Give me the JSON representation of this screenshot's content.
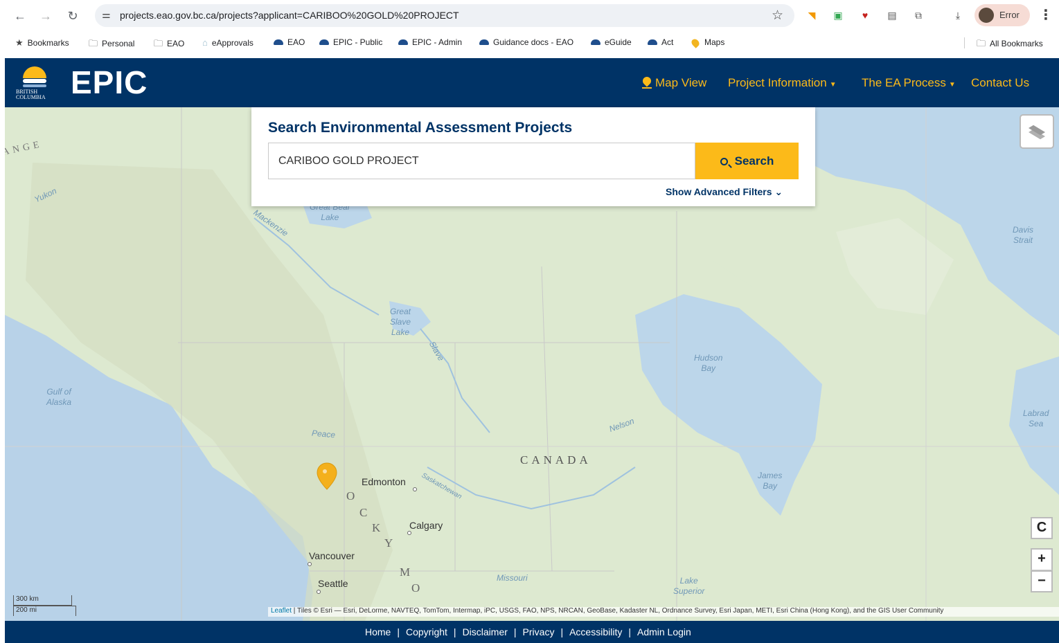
{
  "browser": {
    "url": "projects.eao.gov.bc.ca/projects?applicant=CARIBOO%20GOLD%20PROJECT",
    "profile_label": "Error",
    "bookmarks": [
      {
        "label": "Bookmarks",
        "icon": "star-icon"
      },
      {
        "label": "Personal",
        "icon": "folder-icon"
      },
      {
        "label": "EAO",
        "icon": "folder-icon"
      },
      {
        "label": "eApprovals",
        "icon": "site-icon"
      },
      {
        "label": "EAO",
        "icon": "bc-cloud-icon"
      },
      {
        "label": "EPIC - Public",
        "icon": "bc-cloud-icon"
      },
      {
        "label": "EPIC - Admin",
        "icon": "bc-cloud-icon"
      },
      {
        "label": "Guidance docs - EAO",
        "icon": "bc-cloud-icon"
      },
      {
        "label": "eGuide",
        "icon": "bc-cloud-icon"
      },
      {
        "label": "Act",
        "icon": "bc-cloud-icon"
      },
      {
        "label": "Maps",
        "icon": "maps-pin-icon"
      }
    ],
    "all_bookmarks": "All Bookmarks"
  },
  "header": {
    "logo_text_1": "BRITISH",
    "logo_text_2": "COLUMBIA",
    "title": "EPIC",
    "nav": {
      "map_view": "Map View",
      "project_information": "Project Information",
      "ea_process": "The EA Process",
      "contact": "Contact Us"
    }
  },
  "search": {
    "heading": "Search Environmental Assessment Projects",
    "value": "CARIBOO GOLD PROJECT",
    "button": "Search",
    "advanced": "Show Advanced Filters"
  },
  "map": {
    "water_labels": {
      "great_bear": "Great Bear\nLake",
      "mackenzie": "Mackenzie",
      "great_slave": "Great\nSlave\nLake",
      "slave": "Slave",
      "hudson": "Hudson\nBay",
      "james": "James\nBay",
      "gulf_alaska": "Gulf of\nAlaska",
      "davis": "Davis\nStrait",
      "labrador": "Labrad\nSea",
      "yukon": "Yukon",
      "peace": "Peace",
      "nelson": "Nelson",
      "saskatchewan": "Saskatchewan",
      "missouri": "Missouri",
      "lake_superior": "Lake\nSuperior",
      "range": "ANGE"
    },
    "country": "CANADA",
    "rocky": [
      "O",
      "C",
      "K",
      "Y",
      "M",
      "O"
    ],
    "cities": {
      "edmonton": "Edmonton",
      "calgary": "Calgary",
      "vancouver": "Vancouver",
      "seattle": "Seattle"
    },
    "scale_km": "300 km",
    "scale_mi": "200 mi",
    "attribution_leaflet": "Leaflet",
    "attribution_rest": " | Tiles © Esri — Esri, DeLorme, NAVTEQ, TomTom, Intermap, iPC, USGS, FAO, NPS, NRCAN, GeoBase, Kadaster NL, Ordnance Survey, Esri Japan, METI, Esri China (Hong Kong), and the GIS User Community",
    "controls": {
      "refresh": "C",
      "zoom_in": "+",
      "zoom_out": "−"
    },
    "marker_color": "#f4b01c"
  },
  "footer": {
    "links": [
      "Home",
      "Copyright",
      "Disclaimer",
      "Privacy",
      "Accessibility",
      "Admin Login"
    ]
  },
  "colors": {
    "brand_blue": "#003366",
    "brand_gold": "#fcba19"
  }
}
